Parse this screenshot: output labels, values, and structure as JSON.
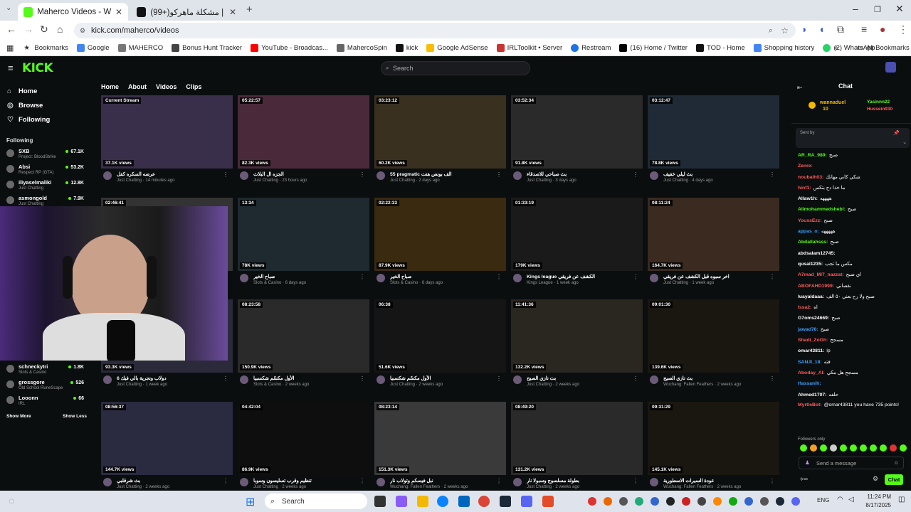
{
  "browser": {
    "tabs": [
      {
        "title": "Maherco Videos - Watch On-D",
        "active": true
      },
      {
        "title": "(99+)مشكلة ماهركو | TikTok",
        "active": false
      }
    ],
    "url": "kick.com/maherco/videos",
    "bookmarks": [
      "Bookmarks",
      "Google",
      "MAHERCO",
      "Bonus Hunt Tracker",
      "YouTube - Broadcas...",
      "MahercoSpin",
      "kick",
      "Google AdSense",
      "IRLToolkit • Server",
      "Restream",
      "(16) Home / Twitter",
      "TOD - Home",
      "Shopping history",
      "(2) WhatsApp"
    ],
    "all_bookmarks": "All Bookmarks"
  },
  "kick": {
    "logo": "KICK",
    "search_placeholder": "Search",
    "nav": [
      "Home",
      "Browse",
      "Following"
    ],
    "following_label": "Following",
    "following": [
      {
        "name": "SXB",
        "sub": "Project: BloodStrike",
        "viewers": "67.1K"
      },
      {
        "name": "Absi",
        "sub": "Respect RP (GTA)",
        "viewers": "53.2K"
      },
      {
        "name": "iliyaselmaliki",
        "sub": "Just Chatting",
        "viewers": "12.8K"
      },
      {
        "name": "asmongold",
        "sub": "Just Chatting",
        "viewers": "7.9K"
      }
    ],
    "following_lower": [
      {
        "name": "schneckyIri",
        "sub": "Slots & Casino",
        "viewers": "1.8K"
      },
      {
        "name": "grossgore",
        "sub": "Old School RuneScape",
        "viewers": "526"
      },
      {
        "name": "Looonn",
        "sub": "IRL",
        "viewers": "66"
      }
    ],
    "show_more": "Show More",
    "show_less": "Show Less",
    "content_tabs": [
      "Home",
      "About",
      "Videos",
      "Clips"
    ]
  },
  "videos": [
    {
      "dur": "Current Stream",
      "views": "37.1K views",
      "title": "عرضه السكره كفل",
      "cat": "Just Chatting",
      "age": "14 minutes ago",
      "color": "#3a2f4a"
    },
    {
      "dur": "05:22:57",
      "views": "82.3K views",
      "title": "الجزه ال البلاث",
      "cat": "Just Chatting",
      "age": "23 hours ago",
      "color": "#4a2a3a"
    },
    {
      "dur": "03:23:12",
      "views": "60.2K views",
      "title": "55 pragmatic الف بونص هنت",
      "cat": "Just Chatting",
      "age": "2 days ago",
      "color": "#3a3020"
    },
    {
      "dur": "03:52:34",
      "views": "91.8K views",
      "title": "بث صباحي للاصدقاء",
      "cat": "Just Chatting",
      "age": "3 days ago",
      "color": "#2a2a2a"
    },
    {
      "dur": "03:12:47",
      "views": "78.8K views",
      "title": "بث ليلي خفيف",
      "cat": "Just Chatting",
      "age": "4 days ago",
      "color": "#1f2a36"
    },
    {
      "dur": "02:46:41",
      "views": "",
      "title": "",
      "cat": "",
      "age": "",
      "color": "#333"
    },
    {
      "dur": "13:34",
      "views": "78K views",
      "title": "صباح الخير",
      "cat": "Slots & Casino",
      "age": "6 days ago",
      "color": "#1e2a30"
    },
    {
      "dur": "02:22:33",
      "views": "87.9K views",
      "title": "صباح الخير",
      "cat": "Slots & Casino",
      "age": "6 days ago",
      "color": "#3a2a10"
    },
    {
      "dur": "01:33:19",
      "views": "179K views",
      "title": "Kings league الكشف عن فريقي",
      "cat": "Kings League",
      "age": "1 week ago",
      "color": "#1a1a1a"
    },
    {
      "dur": "08:11:24",
      "views": "164.7K views",
      "title": "اخر سبوه قبل الكشف عن فريقي",
      "cat": "Just Chatting",
      "age": "1 week ago",
      "color": "#3a2a20"
    },
    {
      "dur": "",
      "views": "93.3K views",
      "title": "6 دولاب ونجرية بالي فيك",
      "cat": "Just Chatting",
      "age": "1 week ago",
      "color": "#2a2a3a"
    },
    {
      "dur": "08:23:58",
      "views": "150.9K views",
      "title": "الأول مكسّم شكسبيا",
      "cat": "Slots & Casino",
      "age": "2 weeks ago",
      "color": "#2a2a2a"
    },
    {
      "dur": "06:38",
      "views": "51.6K views",
      "title": "الأول مكسّم شكسبيا",
      "cat": "Just Chatting",
      "age": "2 weeks ago",
      "color": "#151515"
    },
    {
      "dur": "11:41:36",
      "views": "132.2K views",
      "title": "بث نازي الصيح",
      "cat": "Just Chatting",
      "age": "2 weeks ago",
      "color": "#2a2620"
    },
    {
      "dur": "09:01:30",
      "views": "139.6K views",
      "title": "بث نازي الصيح",
      "cat": "Wuchang: Fallen Feathers",
      "age": "2 weeks ago",
      "color": "#1a1710"
    },
    {
      "dur": "08:56:37",
      "views": "144.7K views",
      "title": "بث شرقلبي",
      "cat": "Just Chatting",
      "age": "2 weeks ago",
      "color": "#2a2a40"
    },
    {
      "dur": "04:42:04",
      "views": "86.9K views",
      "title": "تنظيم وقرب تسليسون وسوبا",
      "cat": "Just Chatting",
      "age": "2 weeks ago",
      "color": "#0e0e0e"
    },
    {
      "dur": "08:23:14",
      "views": "151.3K views",
      "title": "نبل فيسكم وتولاب نار",
      "cat": "Wuchang: Fallen Feathers",
      "age": "2 weeks ago",
      "color": "#3a3a3a"
    },
    {
      "dur": "08:49:20",
      "views": "131.2K views",
      "title": "بطولة مسلسوج وسبولا نار",
      "cat": "Just Chatting",
      "age": "2 weeks ago",
      "color": "#2a2a2a"
    },
    {
      "dur": "09:31:29",
      "views": "145.1K views",
      "title": "عودة السيرات الاسطورية",
      "cat": "Wuchang: Fallen Feathers",
      "age": "2 weeks ago",
      "color": "#1a1710"
    }
  ],
  "chat": {
    "title": "Chat",
    "pinned_label": "Sent by",
    "top_gifters": [
      {
        "name": "wannaduel",
        "count": "10"
      },
      {
        "name": "Yasinnn22",
        "count": "1"
      },
      {
        "name": "Hussein930",
        "count": "1"
      }
    ],
    "messages": [
      {
        "user": "AR_RA_989:",
        "text": "صبح",
        "color": "#53fc18"
      },
      {
        "user": "Zenre:",
        "text": "",
        "color": "#ff5a5a"
      },
      {
        "user": "noubaih03:",
        "text": "شكي كاني مهاتك",
        "color": "#ff5a5a"
      },
      {
        "user": "hinf1:",
        "text": "ما خذا دح بتكس",
        "color": "#ff5a5a"
      },
      {
        "user": "Allaw1h:",
        "text": "ههههه",
        "color": "#fff"
      },
      {
        "user": "Allmohammedshebl:",
        "text": "صبح",
        "color": "#53fc18"
      },
      {
        "user": "YoussEzz:",
        "text": "صبح",
        "color": "#ff5a5a"
      },
      {
        "user": "appas_o:",
        "text": "هههههه",
        "color": "#39a0ff"
      },
      {
        "user": "Abdallahsss:",
        "text": "صبح",
        "color": "#53fc18"
      },
      {
        "user": "abdsalam12745:",
        "text": "",
        "color": "#fff"
      },
      {
        "user": "qusai1235:",
        "text": "مكس ما تجب",
        "color": "#fff"
      },
      {
        "user": "A7mad_Ml7_nazzat:",
        "text": "اي صبح",
        "color": "#ff5a5a"
      },
      {
        "user": "ABOFAHD1999:",
        "text": "نقصاني",
        "color": "#ff5a5a"
      },
      {
        "user": "luayaldaaa:",
        "text": "صبح ولا رح بعني ٥٠ الف",
        "color": "#fff"
      },
      {
        "user": "Issa2:",
        "text": "اه",
        "color": "#ff5a5a"
      },
      {
        "user": "G7oms24669:",
        "text": "صبح",
        "color": "#fff"
      },
      {
        "user": "jawad78:",
        "text": "صبح",
        "color": "#39a0ff"
      },
      {
        "user": "Shadi_ZoGh:",
        "text": "مسجح",
        "color": "#ff5a5a"
      },
      {
        "user": "omar43811:",
        "text": "lp",
        "color": "#fff"
      },
      {
        "user": "SANJI_18:",
        "text": "فته",
        "color": "#39a0ff"
      },
      {
        "user": "Aboday_AI:",
        "text": "مسجح هل مكي",
        "color": "#ff5a5a"
      },
      {
        "user": "Hassanih:",
        "text": "",
        "color": "#39a0ff"
      },
      {
        "user": "Ahmed1707:",
        "text": "حلفه",
        "color": "#fff"
      },
      {
        "user": "MyrtleBot:",
        "text": "@omar43811 you have 735 points!",
        "color": "#ff5a5a"
      }
    ],
    "followers_only": "Followers only",
    "input_placeholder": "Send a message",
    "send_label": "Chat"
  },
  "taskbar": {
    "search": "Search",
    "lang": "ENG",
    "time": "11:24 PM",
    "date": "8/17/2025"
  }
}
